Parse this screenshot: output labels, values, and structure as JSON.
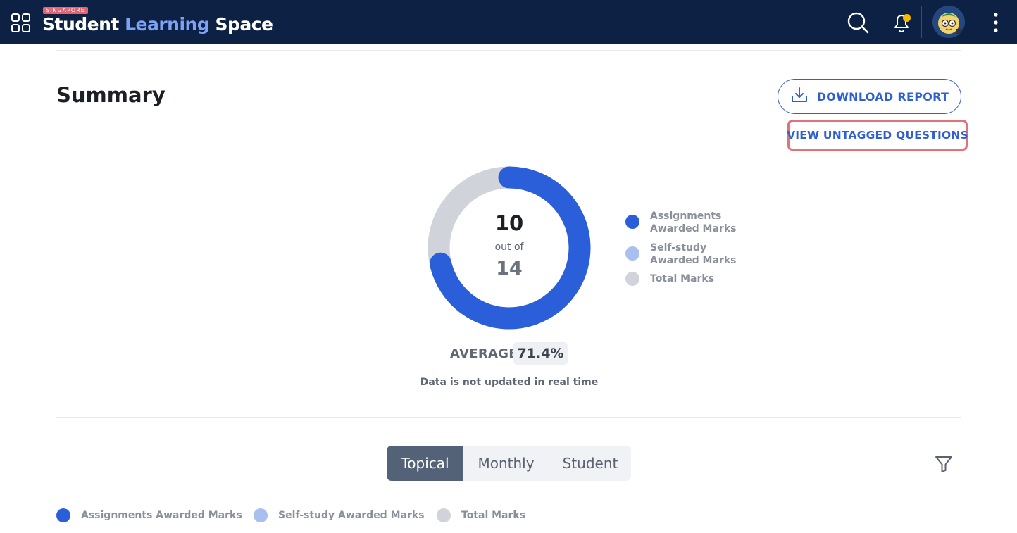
{
  "header": {
    "logo_tag": "SINGAPORE",
    "logo_word1": "Student",
    "logo_word2": "Learning",
    "logo_word3": "Space",
    "icons": [
      "apps-grid-icon",
      "search-icon",
      "bell-icon",
      "avatar",
      "more-vertical-icon"
    ],
    "notification_dot_color": "#f6b800"
  },
  "summary": {
    "title": "Summary",
    "download_label": "DOWNLOAD REPORT",
    "untagged_label": "VIEW UNTAGGED QUESTIONS",
    "donut": {
      "value": "10",
      "out_of_label": "out of",
      "total": "14"
    },
    "legend": [
      {
        "label_line1": "Assignments",
        "label_line2": "Awarded Marks",
        "color": "#2b5fd9"
      },
      {
        "label_line1": "Self-study",
        "label_line2": "Awarded Marks",
        "color": "#a9bff0"
      },
      {
        "label_line1": "Total Marks",
        "label_line2": "",
        "color": "#d0d4da"
      }
    ],
    "average_label": "AVERAGE",
    "average_value": "71.4%",
    "note": "Data is not updated in real time"
  },
  "tabs": {
    "items": [
      "Topical",
      "Monthly",
      "Student"
    ],
    "active": "Topical"
  },
  "bottom_legend": [
    {
      "label": "Assignments Awarded Marks",
      "color": "#2b5fd9"
    },
    {
      "label": "Self-study Awarded Marks",
      "color": "#a9bff0"
    },
    {
      "label": "Total Marks",
      "color": "#d0d4da"
    }
  ],
  "chart_data": {
    "type": "pie",
    "variant": "donut",
    "slices": [
      {
        "label": "Assignments Awarded Marks",
        "value": 10,
        "color": "#2b5fd9"
      },
      {
        "label": "Self-study Awarded Marks",
        "value": 0,
        "color": "#a9bff0"
      },
      {
        "label": "Total Marks",
        "value": 14,
        "color": "#d0d4da"
      }
    ],
    "center_text": [
      "10",
      "out of",
      "14"
    ]
  }
}
